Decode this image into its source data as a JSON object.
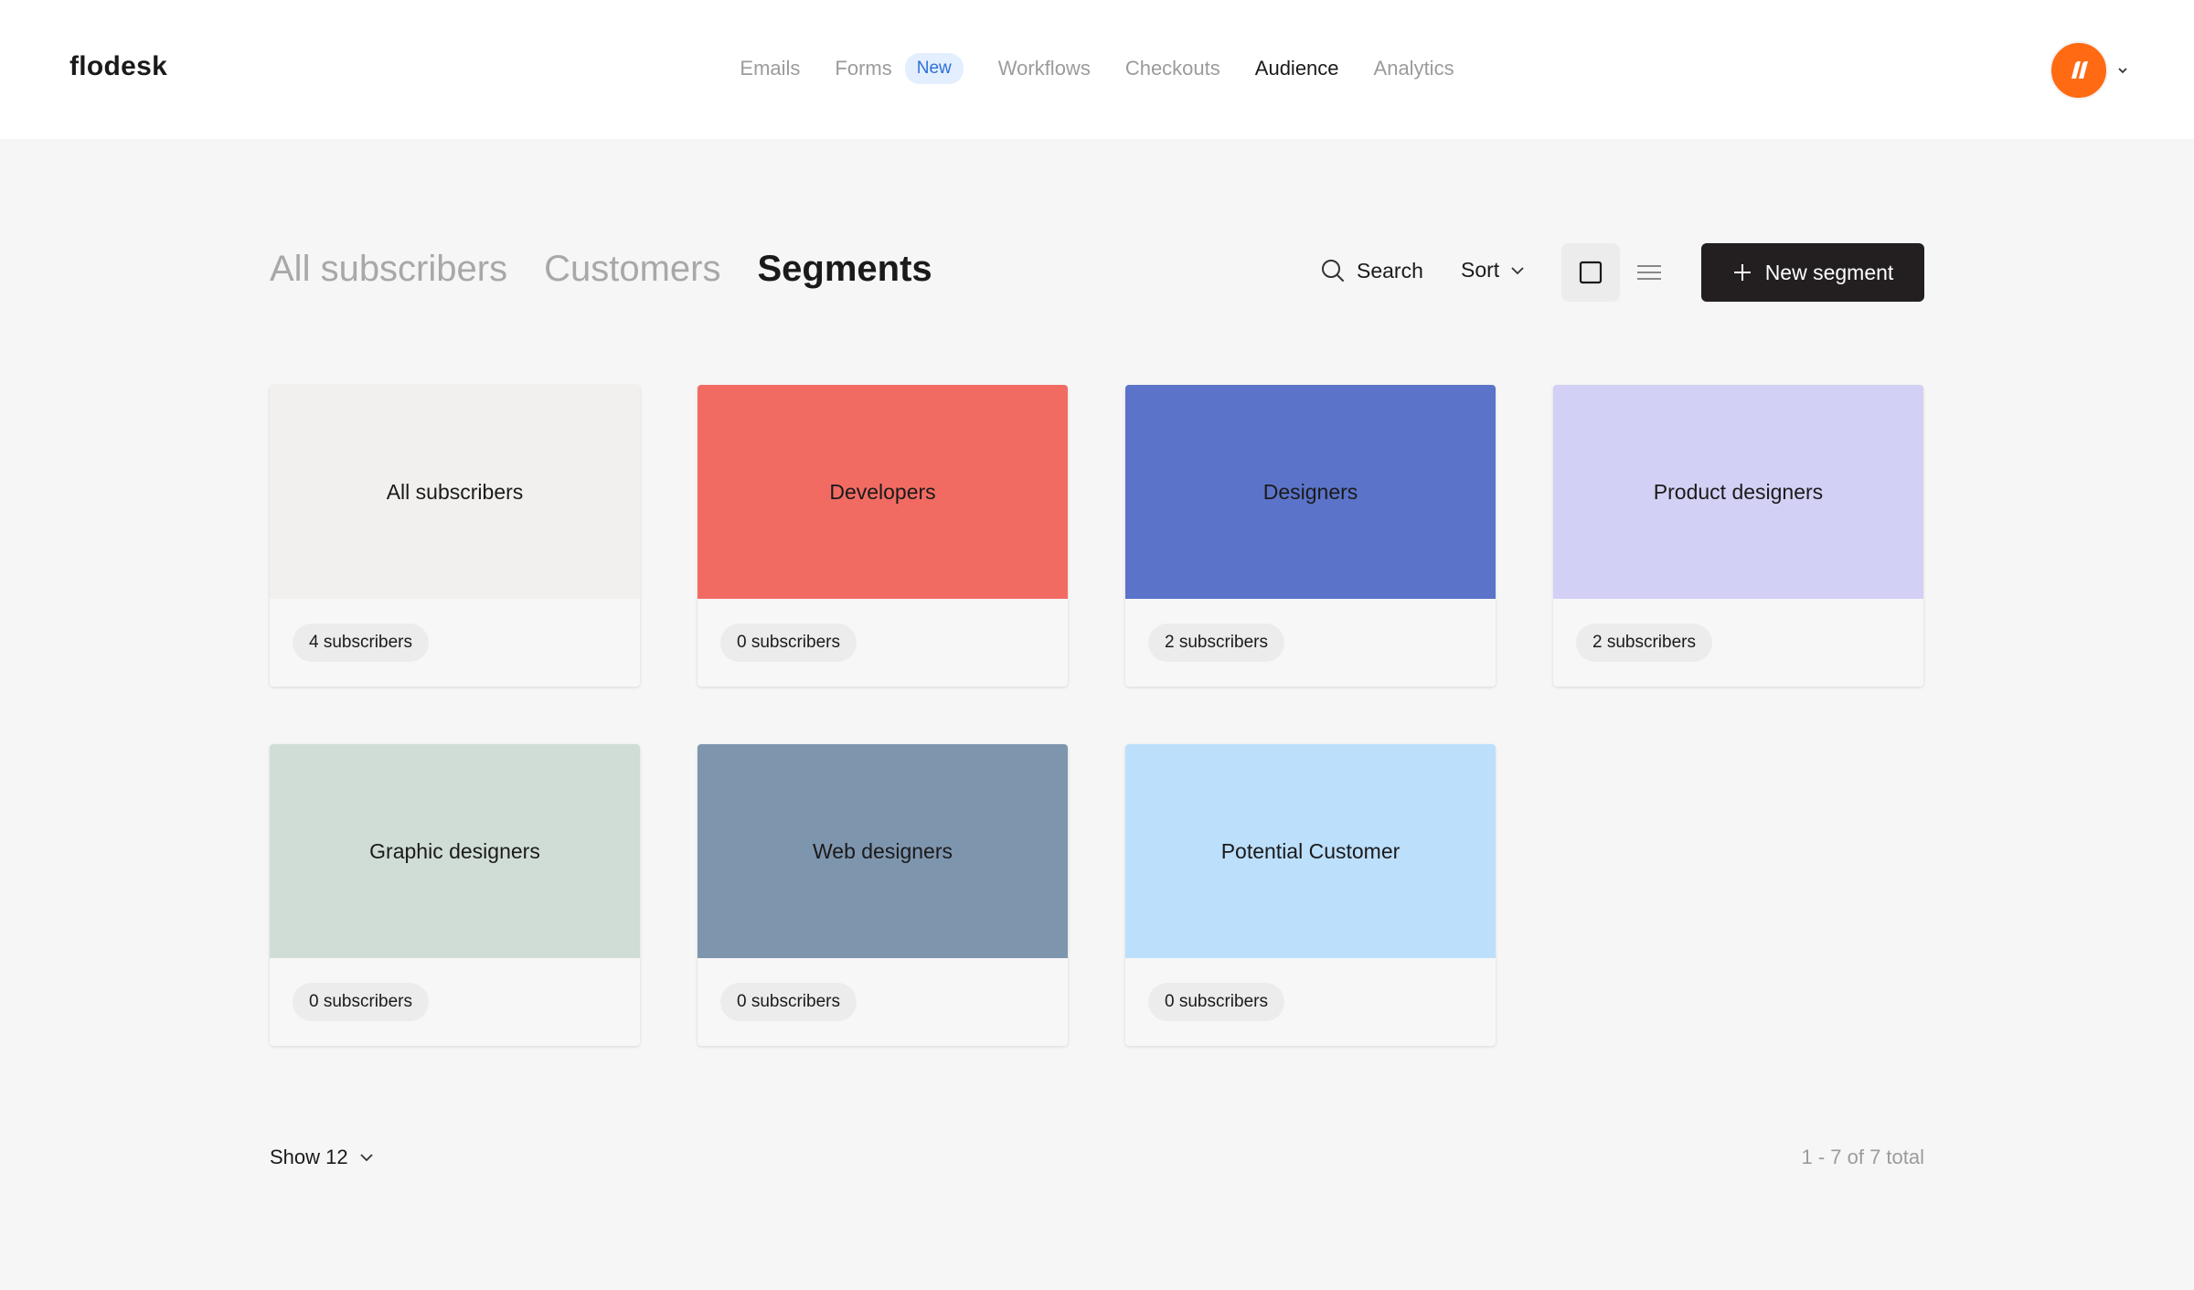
{
  "header": {
    "logo": "flodesk",
    "nav": [
      {
        "label": "Emails",
        "active": false
      },
      {
        "label": "Forms",
        "active": false,
        "badge": "New"
      },
      {
        "label": "Workflows",
        "active": false
      },
      {
        "label": "Checkouts",
        "active": false
      },
      {
        "label": "Audience",
        "active": true
      },
      {
        "label": "Analytics",
        "active": false
      }
    ],
    "avatar_icon": "brand-logo-icon",
    "avatar_color": "#ff6a13"
  },
  "tabs": [
    {
      "label": "All subscribers",
      "active": false
    },
    {
      "label": "Customers",
      "active": false
    },
    {
      "label": "Segments",
      "active": true
    }
  ],
  "toolbar": {
    "search_label": "Search",
    "sort_label": "Sort",
    "new_segment_label": "New segment",
    "view_mode": "grid"
  },
  "segments": [
    {
      "name": "All subscribers",
      "count": "4 subscribers",
      "color": "#f1f0ee"
    },
    {
      "name": "Developers",
      "count": "0 subscribers",
      "color": "#f26b63"
    },
    {
      "name": "Designers",
      "count": "2 subscribers",
      "color": "#5b73c9"
    },
    {
      "name": "Product designers",
      "count": "2 subscribers",
      "color": "#d3d0f5"
    },
    {
      "name": "Graphic designers",
      "count": "0 subscribers",
      "color": "#d0ddd6"
    },
    {
      "name": "Web designers",
      "count": "0 subscribers",
      "color": "#7e95ae"
    },
    {
      "name": "Potential Customer",
      "count": "0 subscribers",
      "color": "#bcdffb"
    }
  ],
  "footer": {
    "show_label": "Show 12",
    "total_label": "1 - 7 of 7 total"
  }
}
